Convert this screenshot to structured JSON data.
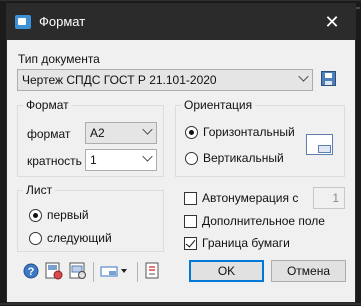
{
  "window": {
    "title": "Формат",
    "close_glyph": "✕"
  },
  "doc_type": {
    "label": "Тип документа",
    "value": "Чертеж СПДС ГОСТ Р 21.101-2020"
  },
  "format_group": {
    "title": "Формат",
    "format_label": "формат",
    "format_value": "A2",
    "multiplicity_label": "кратность",
    "multiplicity_value": "1"
  },
  "orientation_group": {
    "title": "Ориентация",
    "options": [
      "Горизонтальный",
      "Вертикальный"
    ],
    "selected": "Горизонтальный"
  },
  "sheet_group": {
    "title": "Лист",
    "options": [
      "первый",
      "следующий"
    ],
    "selected": "первый"
  },
  "options": {
    "autonumber_label": "Автонумерация с",
    "autonumber_checked": false,
    "autonumber_value": "1",
    "extra_field_label": "Дополнительное поле",
    "extra_field_checked": false,
    "paper_border_label": "Граница бумаги",
    "paper_border_checked": true
  },
  "buttons": {
    "ok": "OK",
    "cancel": "Отмена"
  },
  "icons": [
    "help-icon",
    "page-settings-icon",
    "preview-icon",
    "layout-dropdown-icon",
    "text-settings-icon",
    "save-icon",
    "sheet-orientation-icon"
  ],
  "colors": {
    "titlebar": "#2b2b2b",
    "dialog": "#f0f0f0",
    "accent": "#0078d7",
    "icon_blue": "#4f7fb8"
  }
}
